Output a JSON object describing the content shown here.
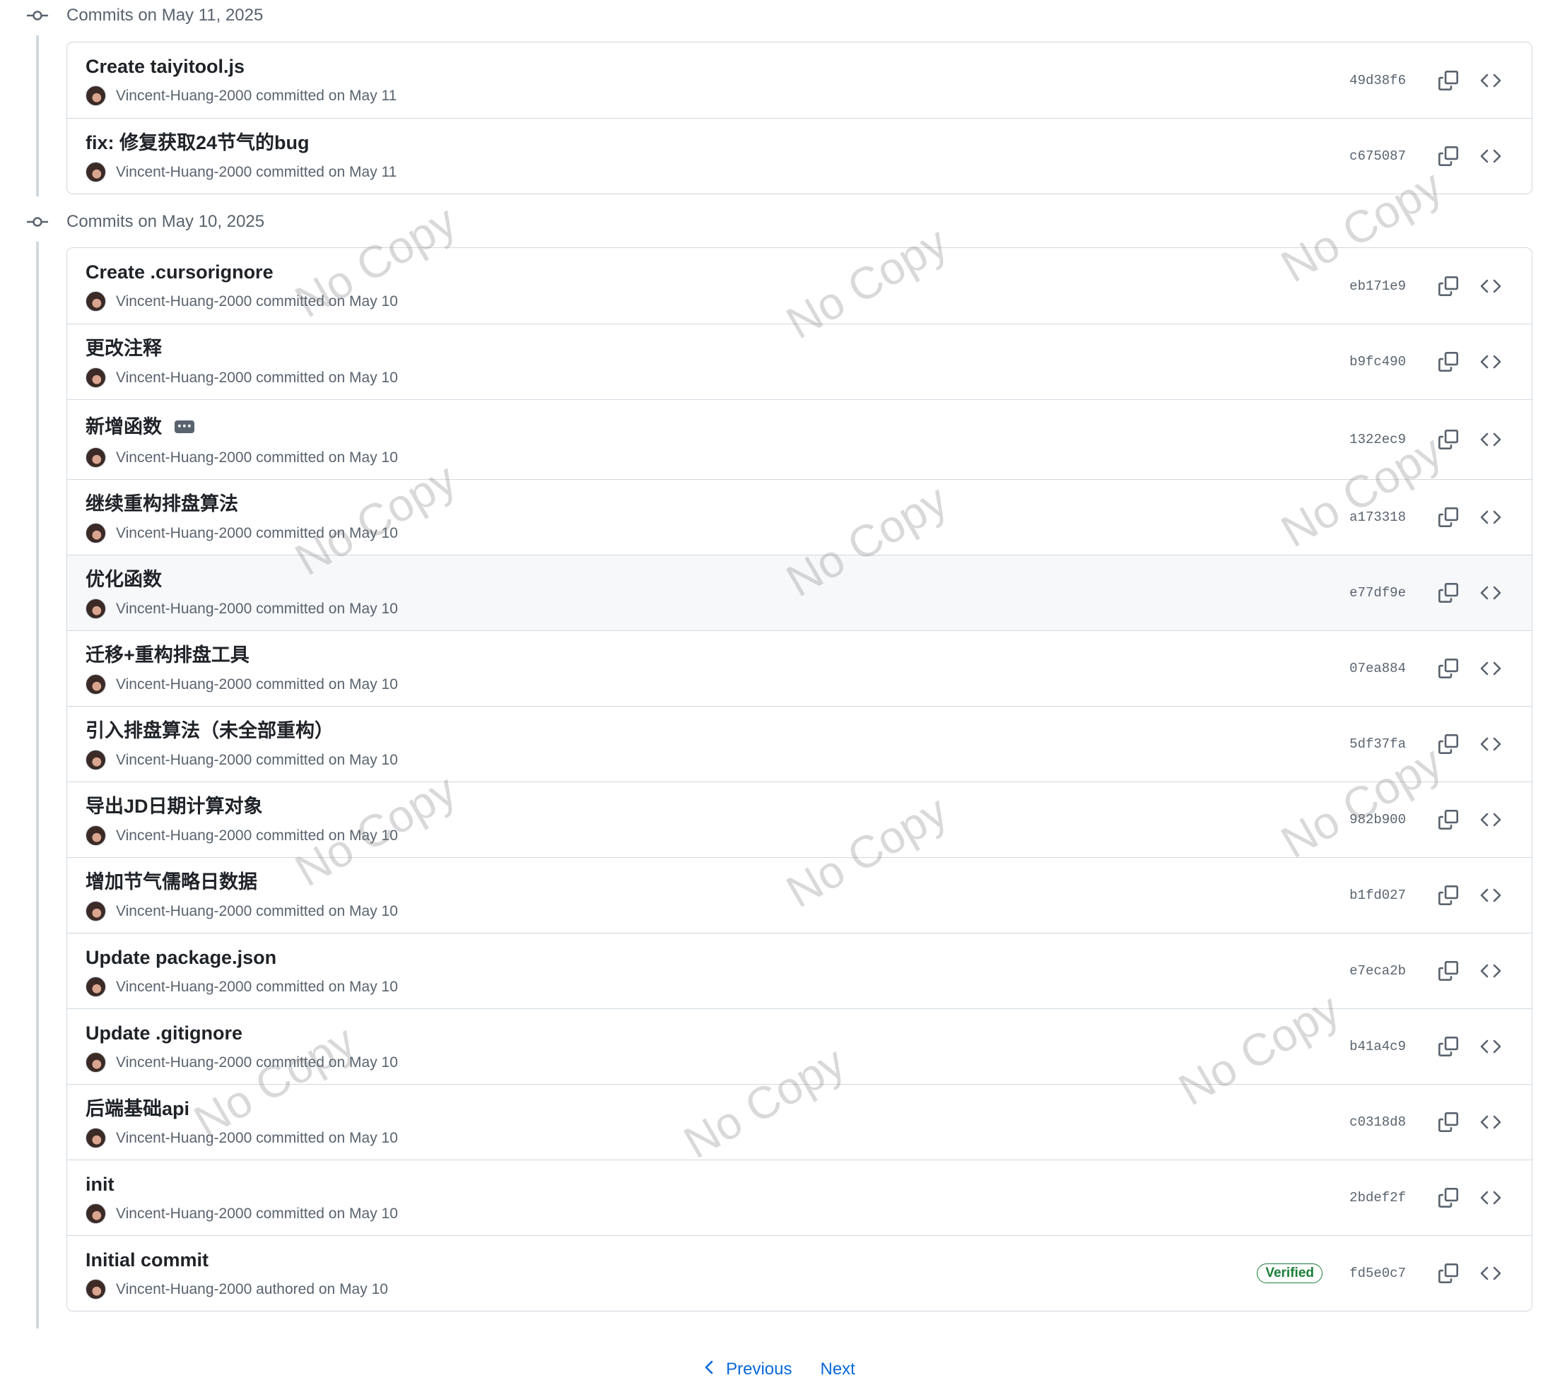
{
  "groups": [
    {
      "title": "Commits on May 11, 2025",
      "commits": [
        {
          "message": "Create taiyitool.js",
          "author": "Vincent-Huang-2000",
          "action": "committed on",
          "date": "May 11",
          "sha": "49d38f6"
        },
        {
          "message": "fix: 修复获取24节气的bug",
          "author": "Vincent-Huang-2000",
          "action": "committed on",
          "date": "May 11",
          "sha": "c675087"
        }
      ]
    },
    {
      "title": "Commits on May 10, 2025",
      "commits": [
        {
          "message": "Create .cursorignore",
          "author": "Vincent-Huang-2000",
          "action": "committed on",
          "date": "May 10",
          "sha": "eb171e9"
        },
        {
          "message": "更改注释",
          "author": "Vincent-Huang-2000",
          "action": "committed on",
          "date": "May 10",
          "sha": "b9fc490"
        },
        {
          "message": "新增函数",
          "author": "Vincent-Huang-2000",
          "action": "committed on",
          "date": "May 10",
          "sha": "1322ec9",
          "has_ellipsis": true
        },
        {
          "message": "继续重构排盘算法",
          "author": "Vincent-Huang-2000",
          "action": "committed on",
          "date": "May 10",
          "sha": "a173318"
        },
        {
          "message": "优化函数",
          "author": "Vincent-Huang-2000",
          "action": "committed on",
          "date": "May 10",
          "sha": "e77df9e",
          "hovered": true
        },
        {
          "message": "迁移+重构排盘工具",
          "author": "Vincent-Huang-2000",
          "action": "committed on",
          "date": "May 10",
          "sha": "07ea884"
        },
        {
          "message": "引入排盘算法（未全部重构）",
          "author": "Vincent-Huang-2000",
          "action": "committed on",
          "date": "May 10",
          "sha": "5df37fa"
        },
        {
          "message": "导出JD日期计算对象",
          "author": "Vincent-Huang-2000",
          "action": "committed on",
          "date": "May 10",
          "sha": "982b900"
        },
        {
          "message": "增加节气儒略日数据",
          "author": "Vincent-Huang-2000",
          "action": "committed on",
          "date": "May 10",
          "sha": "b1fd027"
        },
        {
          "message": "Update package.json",
          "author": "Vincent-Huang-2000",
          "action": "committed on",
          "date": "May 10",
          "sha": "e7eca2b"
        },
        {
          "message": "Update .gitignore",
          "author": "Vincent-Huang-2000",
          "action": "committed on",
          "date": "May 10",
          "sha": "b41a4c9"
        },
        {
          "message": "后端基础api",
          "author": "Vincent-Huang-2000",
          "action": "committed on",
          "date": "May 10",
          "sha": "c0318d8"
        },
        {
          "message": "init",
          "author": "Vincent-Huang-2000",
          "action": "committed on",
          "date": "May 10",
          "sha": "2bdef2f"
        },
        {
          "message": "Initial commit",
          "author": "Vincent-Huang-2000",
          "action": "authored on",
          "date": "May 10",
          "sha": "fd5e0c7",
          "badge": "Verified"
        }
      ]
    }
  ],
  "pagination": {
    "previous": "Previous",
    "next": "Next"
  },
  "watermark_text": "No Copy",
  "icons": {
    "group": "git-commit-icon",
    "copy": "copy-icon",
    "browse": "code-icon",
    "prev": "chevron-left-icon"
  },
  "colors": {
    "link": "#0969da",
    "muted": "#59636e",
    "border": "#d1d9e0",
    "verified": "#1a7f37"
  }
}
